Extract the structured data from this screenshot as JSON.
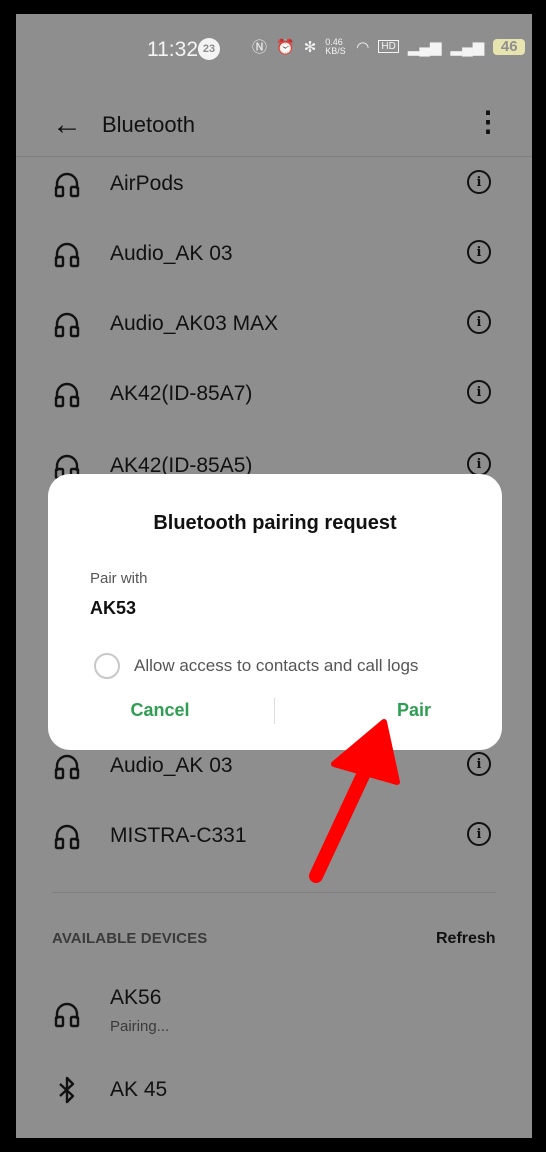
{
  "status_bar": {
    "time": "11:32",
    "notification_count": "23",
    "net_speed": "0.46 KB/S",
    "battery": "46"
  },
  "header": {
    "back_label": "←",
    "title": "Bluetooth",
    "more_label": "⋮"
  },
  "paired_devices": [
    {
      "name": "AirPods"
    },
    {
      "name": "Audio_AK 03"
    },
    {
      "name": "Audio_AK03 MAX"
    },
    {
      "name": "AK42(ID-85A7)"
    },
    {
      "name": "AK42(ID-85A5)"
    },
    {
      "name": "Audio_AK 03"
    },
    {
      "name": "MISTRA-C331"
    }
  ],
  "info_glyph": "i",
  "available": {
    "section_title": "AVAILABLE DEVICES",
    "refresh_label": "Refresh",
    "devices": [
      {
        "name": "AK56",
        "status": "Pairing...",
        "icon": "headphones-icon"
      },
      {
        "name": "AK 45",
        "status": "",
        "icon": "bluetooth-icon"
      }
    ]
  },
  "dialog": {
    "title": "Bluetooth pairing request",
    "pair_with_label": "Pair with",
    "device_name": "AK53",
    "checkbox_label": "Allow access to contacts and call logs",
    "cancel_label": "Cancel",
    "pair_label": "Pair"
  },
  "colors": {
    "accent_green": "#2e9e52",
    "overlay_gray": "#8e8e8e",
    "annotation_red": "#ff0000"
  }
}
